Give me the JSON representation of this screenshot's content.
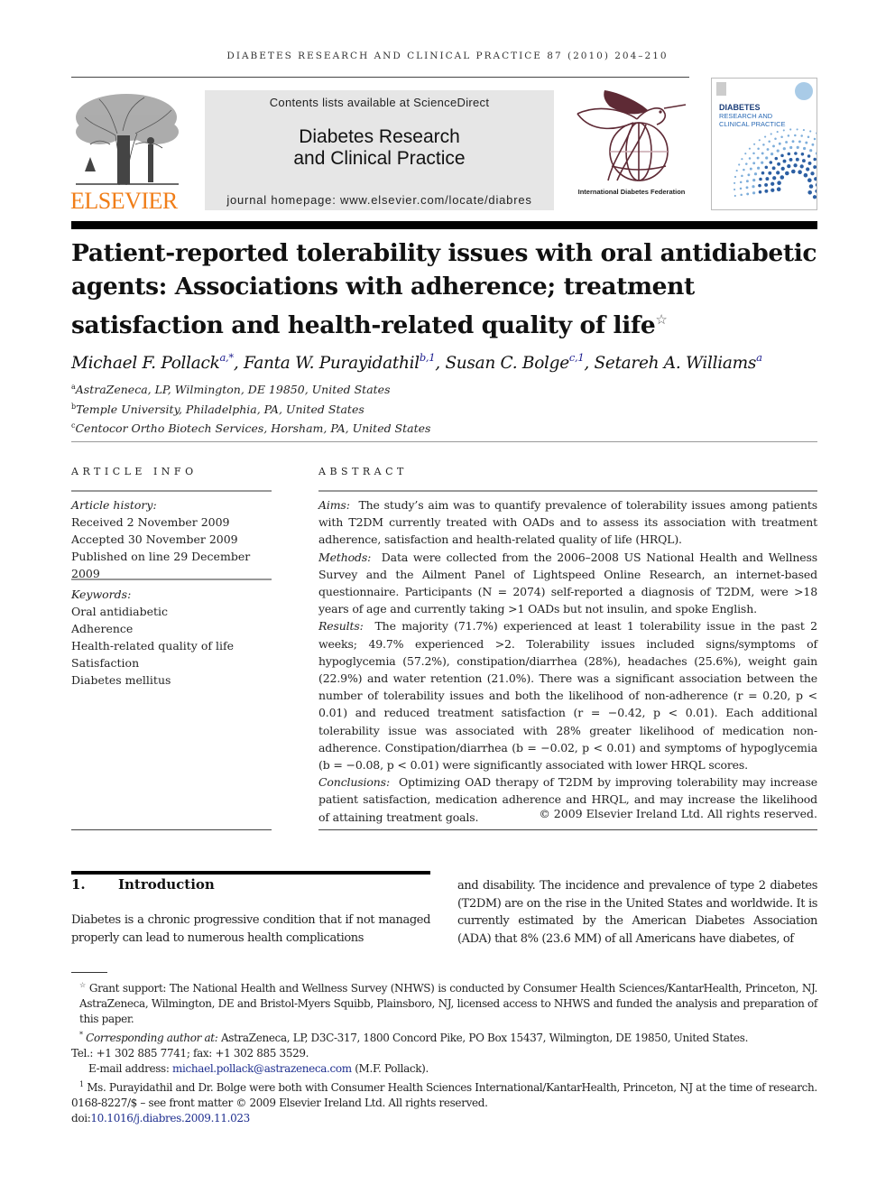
{
  "running_head": "DIABETES RESEARCH AND CLINICAL PRACTICE 87 (2010) 204–210",
  "header": {
    "publisher_logo_text": "ELSEVIER",
    "contents_line": "Contents lists available at ScienceDirect",
    "journal_title_line1": "Diabetes Research",
    "journal_title_line2": "and Clinical Practice",
    "homepage_line": "journal homepage: www.elsevier.com/locate/diabres",
    "idf_caption": "International Diabetes Federation",
    "cover": {
      "title_line1": "DIABETES",
      "title_line2": "RESEARCH AND",
      "title_line3": "CLINICAL PRACTICE"
    },
    "colors": {
      "elsevier_orange": "#f07d17",
      "idf_maroon": "#5e2a35",
      "cover_blue": "#2a6ab5"
    }
  },
  "article": {
    "title": "Patient-reported tolerability issues with oral antidiabetic agents: Associations with adherence; treatment satisfaction and health-related quality of life",
    "title_note_mark": "☆",
    "authors": [
      {
        "name": "Michael F. Pollack",
        "sup": "a,*"
      },
      {
        "name": "Fanta W. Purayidathil",
        "sup": "b,1"
      },
      {
        "name": "Susan C. Bolge",
        "sup": "c,1"
      },
      {
        "name": "Setareh A. Williams",
        "sup": "a"
      }
    ],
    "affiliations": [
      {
        "mark": "a",
        "text": "AstraZeneca, LP, Wilmington, DE 19850, United States"
      },
      {
        "mark": "b",
        "text": "Temple University, Philadelphia, PA, United States"
      },
      {
        "mark": "c",
        "text": "Centocor Ortho Biotech Services, Horsham, PA, United States"
      }
    ]
  },
  "article_info": {
    "heading": "ARTICLE INFO",
    "history_label": "Article history:",
    "history": [
      "Received 2 November 2009",
      "Accepted 30 November 2009",
      "Published on line 29 December 2009"
    ],
    "keywords_label": "Keywords:",
    "keywords": [
      "Oral antidiabetic",
      "Adherence",
      "Health-related quality of life",
      "Satisfaction",
      "Diabetes mellitus"
    ]
  },
  "abstract": {
    "heading": "ABSTRACT",
    "sections": [
      {
        "label": "Aims:",
        "text": "The study’s aim was to quantify prevalence of tolerability issues among patients with T2DM currently treated with OADs and to assess its association with treatment adherence, satisfaction and health-related quality of life (HRQL)."
      },
      {
        "label": "Methods:",
        "text": "Data were collected from the 2006–2008 US National Health and Wellness Survey and the Ailment Panel of Lightspeed Online Research, an internet-based questionnaire. Participants (N = 2074) self-reported a diagnosis of T2DM, were >18 years of age and currently taking >1 OADs but not insulin, and spoke English."
      },
      {
        "label": "Results:",
        "text": "The majority (71.7%) experienced at least 1 tolerability issue in the past 2 weeks; 49.7% experienced >2. Tolerability issues included signs/symptoms of hypoglycemia (57.2%), constipation/diarrhea (28%), headaches (25.6%), weight gain (22.9%) and water retention (21.0%). There was a significant association between the number of tolerability issues and both the likelihood of non-adherence (r = 0.20, p < 0.01) and reduced treatment satisfaction (r = −0.42, p < 0.01). Each additional tolerability issue was associated with 28% greater likelihood of medication non-adherence. Constipation/diarrhea (b = −0.02, p < 0.01) and symptoms of hypoglycemia (b = −0.08, p < 0.01) were significantly associated with lower HRQL scores."
      },
      {
        "label": "Conclusions:",
        "text": "Optimizing OAD therapy of T2DM by improving tolerability may increase patient satisfaction, medication adherence and HRQL, and may increase the likelihood of attaining treatment goals."
      }
    ],
    "copyright": "© 2009 Elsevier Ireland Ltd. All rights reserved."
  },
  "introduction": {
    "number": "1.",
    "heading": "Introduction",
    "left_text": "Diabetes is a chronic progressive condition that if not managed properly can lead to numerous health complications",
    "right_text": "and disability. The incidence and prevalence of type 2 diabetes (T2DM) are on the rise in the United States and worldwide. It is currently estimated by the American Diabetes Association (ADA) that 8% (23.6 MM) of all Americans have diabetes, of"
  },
  "footnotes": {
    "grant_mark": "☆",
    "grant": "Grant support: The National Health and Wellness Survey (NHWS) is conducted by Consumer Health Sciences/KantarHealth, Princeton, NJ. AstraZeneca, Wilmington, DE and Bristol-Myers Squibb, Plainsboro, NJ, licensed access to NHWS and funded the analysis and preparation of this paper.",
    "corr_mark": "*",
    "corr_label": "Corresponding author at:",
    "corr_text": "AstraZeneca, LP, D3C-317, 1800 Concord Pike, PO Box 15437, Wilmington, DE 19850, United States.",
    "tel": "Tel.: +1 302 885 7741; fax: +1 302 885 3529.",
    "email_label": "E-mail address:",
    "email": "michael.pollack@astrazeneca.com",
    "email_suffix": "(M.F. Pollack).",
    "note1_mark": "1",
    "note1": "Ms. Purayidathil and Dr. Bolge were both with Consumer Health Sciences International/KantarHealth, Princeton, NJ at the time of research.",
    "issn_line": "0168-8227/$ – see front matter © 2009 Elsevier Ireland Ltd. All rights reserved.",
    "doi_prefix": "doi:",
    "doi": "10.1016/j.diabres.2009.11.023"
  }
}
